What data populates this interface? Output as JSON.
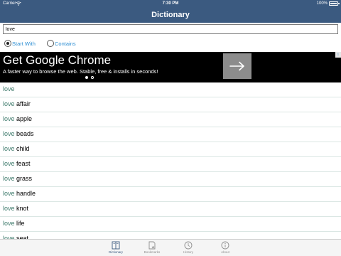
{
  "status_bar": {
    "carrier": "Carrier",
    "time": "7:30 PM",
    "battery": "100%"
  },
  "nav": {
    "title": "Dictionary"
  },
  "search": {
    "value": "love"
  },
  "search_mode": {
    "start_with": "Start With",
    "contains": "Contains",
    "selected": "start_with"
  },
  "ad": {
    "title": "Get Google Chrome",
    "subtitle": "A faster way to browse the web. Stable, free & installs in seconds!",
    "info_glyph": "i"
  },
  "results": [
    {
      "prefix": "love",
      "rest": ""
    },
    {
      "prefix": "love",
      "rest": " affair"
    },
    {
      "prefix": "love",
      "rest": " apple"
    },
    {
      "prefix": "love",
      "rest": " beads"
    },
    {
      "prefix": "love",
      "rest": " child"
    },
    {
      "prefix": "love",
      "rest": " feast"
    },
    {
      "prefix": "love",
      "rest": " grass"
    },
    {
      "prefix": "love",
      "rest": " handle"
    },
    {
      "prefix": "love",
      "rest": " knot"
    },
    {
      "prefix": "love",
      "rest": " life"
    },
    {
      "prefix": "love",
      "rest": " seat"
    }
  ],
  "tabs": [
    {
      "label": "Dictionary",
      "icon": "book-icon",
      "active": true
    },
    {
      "label": "Bookmarks",
      "icon": "bookmark-icon",
      "active": false
    },
    {
      "label": "History",
      "icon": "clock-icon",
      "active": false
    },
    {
      "label": "About",
      "icon": "info-icon",
      "active": false
    }
  ],
  "colors": {
    "nav_bar": "#3b5a80",
    "accent": "#2e8fd3",
    "result_prefix": "#3e7a6c"
  }
}
